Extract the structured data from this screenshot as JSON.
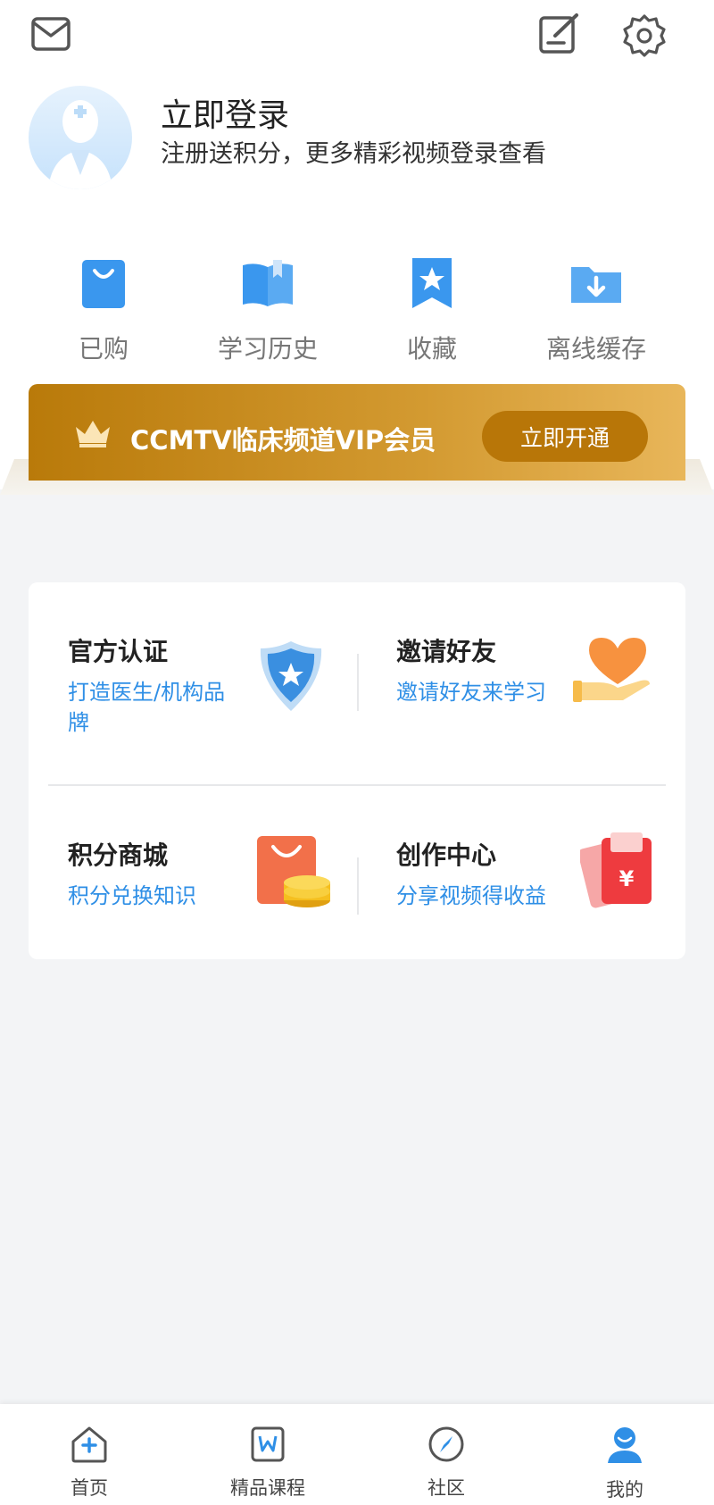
{
  "header": {
    "message_icon": "envelope-icon",
    "edit_icon": "edit-note-icon",
    "settings_icon": "gear-icon"
  },
  "profile": {
    "login_title": "立即登录",
    "login_subtitle": "注册送积分，更多精彩视频登录查看",
    "avatar_icon": "doctor-avatar-icon"
  },
  "quick_actions": [
    {
      "label": "已购",
      "icon": "shopping-bag-icon"
    },
    {
      "label": "学习历史",
      "icon": "open-book-icon"
    },
    {
      "label": "收藏",
      "icon": "star-bookmark-icon"
    },
    {
      "label": "离线缓存",
      "icon": "download-folder-icon"
    }
  ],
  "vip": {
    "title": "CCMTV临床频道VIP会员",
    "button": "立即开通",
    "icon": "crown-icon"
  },
  "services": [
    {
      "title": "官方认证",
      "subtitle": "打造医生/机构品牌",
      "icon": "shield-star-icon"
    },
    {
      "title": "邀请好友",
      "subtitle": "邀请好友来学习",
      "icon": "heart-hand-icon"
    },
    {
      "title": "积分商城",
      "subtitle": "积分兑换知识",
      "icon": "bag-coins-icon"
    },
    {
      "title": "创作中心",
      "subtitle": "分享视频得收益",
      "icon": "red-envelope-icon"
    }
  ],
  "tabs": [
    {
      "label": "首页",
      "icon": "home-plus-icon"
    },
    {
      "label": "精品课程",
      "icon": "course-book-icon"
    },
    {
      "label": "社区",
      "icon": "compass-icon"
    },
    {
      "label": "我的",
      "icon": "user-icon"
    }
  ],
  "colors": {
    "accent": "#2f8fe6",
    "vip_gold": "#c4861c",
    "active_tab": "#2f8fe6"
  }
}
